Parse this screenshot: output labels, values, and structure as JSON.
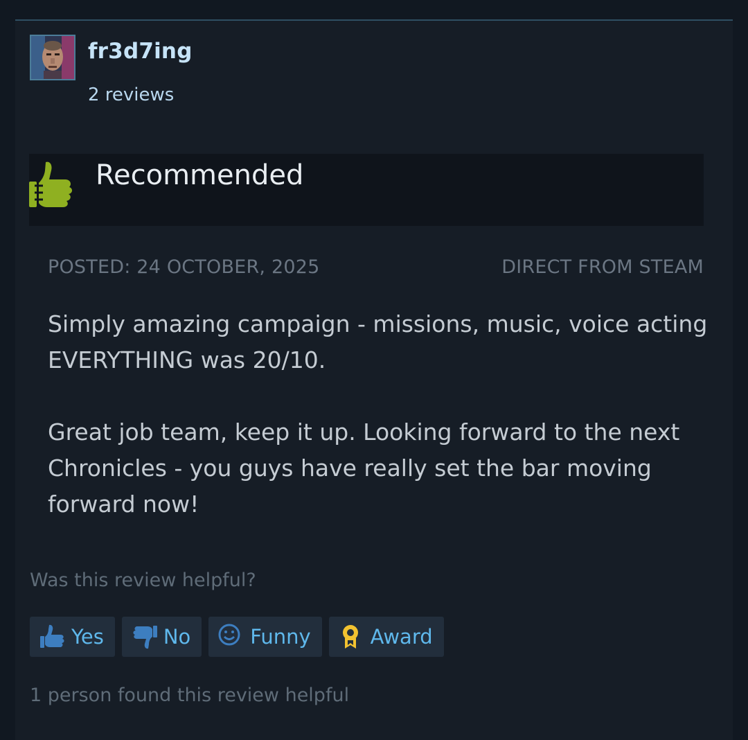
{
  "author": {
    "name": "fr3d7ing",
    "reviews": "2 reviews",
    "avatar_icon": "profile-avatar"
  },
  "verdict": {
    "label": "Recommended",
    "icon": "thumbs-up-icon",
    "color": "#8fb021"
  },
  "meta": {
    "posted": "POSTED: 24 OCTOBER, 2025",
    "source": "DIRECT FROM STEAM"
  },
  "review": {
    "paragraph1": "Simply amazing campaign - missions, music, voice acting EVERYTHING was 20/10.",
    "paragraph2": "Great job team, keep it up. Looking forward to the next Chronicles - you guys have really set the bar moving forward now!"
  },
  "helpful": {
    "question": "Was this review helpful?",
    "yes_label": "Yes",
    "no_label": "No",
    "funny_label": "Funny",
    "award_label": "Award",
    "summary": "1 person found this review helpful",
    "button_text_color": "#5fb8ec",
    "award_color": "#f2c230"
  }
}
